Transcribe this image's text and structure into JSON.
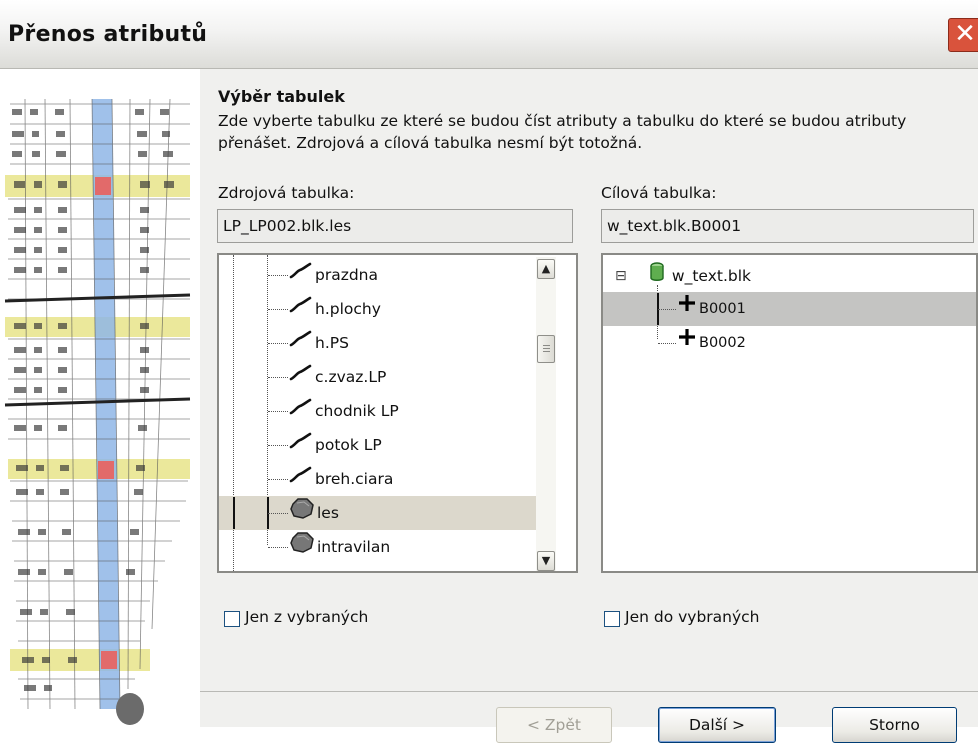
{
  "window": {
    "title": "Přenos atributů",
    "close_glyph": "✕"
  },
  "page": {
    "heading": "Výběr tabulek",
    "description": "Zde vyberte tabulku ze které se budou číst atributy a tabulku do které se budou atributy přenášet. Zdrojová a cílová tabulka nesmí být totožná."
  },
  "source": {
    "label": "Zdrojová tabulka:",
    "value": "LP_LP002.blk.les",
    "items": [
      {
        "label": "prazdna",
        "icon": "line-layer-icon"
      },
      {
        "label": "h.plochy",
        "icon": "line-layer-icon"
      },
      {
        "label": "h.PS",
        "icon": "line-layer-icon"
      },
      {
        "label": "c.zvaz.LP",
        "icon": "line-layer-icon"
      },
      {
        "label": "chodnik LP",
        "icon": "line-layer-icon"
      },
      {
        "label": "potok LP",
        "icon": "line-layer-icon"
      },
      {
        "label": "breh.ciara",
        "icon": "line-layer-icon"
      },
      {
        "label": "les",
        "icon": "polygon-layer-icon",
        "selected": true
      },
      {
        "label": "intravilan",
        "icon": "polygon-layer-icon"
      }
    ],
    "checkbox_label": "Jen z vybraných",
    "checkbox_checked": false
  },
  "target": {
    "label": "Cílová tabulka:",
    "value": "w_text.blk.B0001",
    "root": {
      "label": "w_text.blk",
      "icon": "database-icon",
      "expander": "⊟"
    },
    "items": [
      {
        "label": "B0001",
        "icon": "point-layer-icon",
        "selected": true
      },
      {
        "label": "B0002",
        "icon": "point-layer-icon"
      }
    ],
    "checkbox_label": "Jen do vybraných",
    "checkbox_checked": false
  },
  "buttons": {
    "back": "< Zpět",
    "next": "Další >",
    "cancel": "Storno"
  },
  "colors": {
    "selection_source": "#dcd8cc",
    "selection_target": "#c4c4c2",
    "close_button": "#d9533c"
  }
}
